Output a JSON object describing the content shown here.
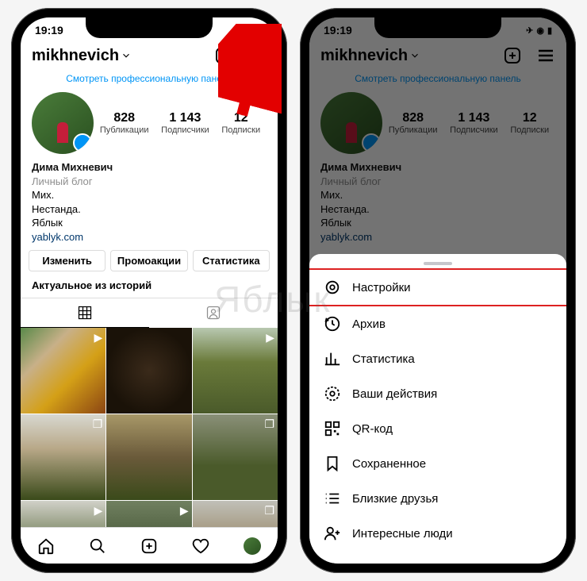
{
  "status": {
    "time": "19:19"
  },
  "header": {
    "username": "mikhnevich"
  },
  "promo_link": "Смотреть профессиональную панель",
  "stats": {
    "posts": {
      "num": "828",
      "label": "Публикации"
    },
    "followers": {
      "num": "1 143",
      "label": "Подписчики"
    },
    "following": {
      "num": "12",
      "label": "Подписки"
    }
  },
  "bio": {
    "name": "Дима Михневич",
    "category": "Личный блог",
    "line1": "Мих.",
    "line2": "Нестанда.",
    "line3": "Яблык",
    "link": "yablyk.com"
  },
  "buttons": {
    "edit": "Изменить",
    "promo": "Промоакции",
    "insights": "Статистика"
  },
  "highlights_title": "Актуальное из историй",
  "sheet": {
    "settings": "Настройки",
    "archive": "Архив",
    "insights": "Статистика",
    "activity": "Ваши действия",
    "qr": "QR-код",
    "saved": "Сохраненное",
    "close_friends": "Близкие друзья",
    "discover": "Интересные люди"
  },
  "watermark": "Яблык"
}
